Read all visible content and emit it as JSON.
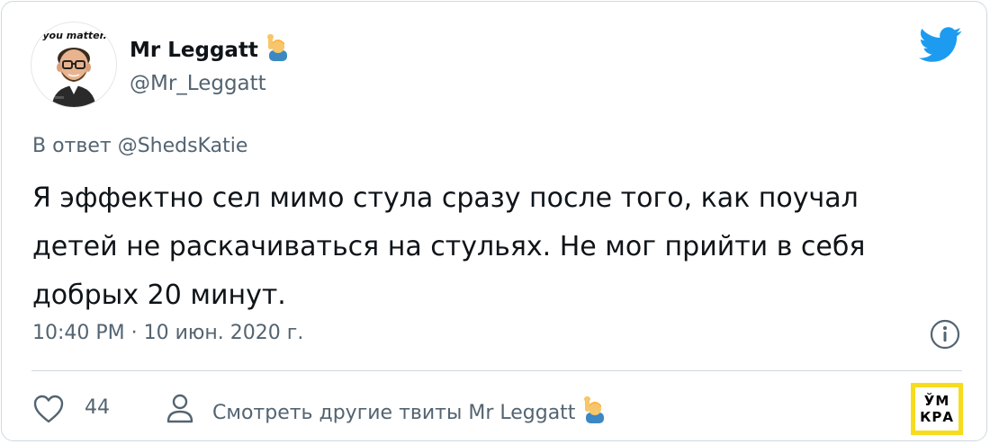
{
  "author": {
    "display_name": "Mr Leggatt",
    "handle": "@Mr_Leggatt",
    "name_emoji": "raising-hand-person-emoji",
    "avatar_caption": "you matter."
  },
  "reply": {
    "prefix": "В ответ",
    "mention": "@ShedsKatie"
  },
  "tweet": {
    "text": "Я эффектно сел мимо стула сразу после того, как поучал детей не раскачиваться на стульях. Не мог прийти в себя добрых 20 минут.",
    "timestamp": "10:40 PM · 10 июн. 2020 г."
  },
  "actions": {
    "like_count": "44",
    "more_tweets_label": "Смотреть другие твиты Mr Leggatt"
  },
  "logo": {
    "line1": "ЎМ",
    "line2": "КРА"
  },
  "icons": {
    "twitter": "twitter-bird-icon",
    "info": "info-icon",
    "like": "heart-icon",
    "profile": "person-icon"
  },
  "colors": {
    "twitter_blue": "#1d9bf0",
    "text_primary": "#0f1419",
    "text_secondary": "#536471",
    "border": "#cfd9de",
    "logo_yellow": "#f7dc1e"
  }
}
